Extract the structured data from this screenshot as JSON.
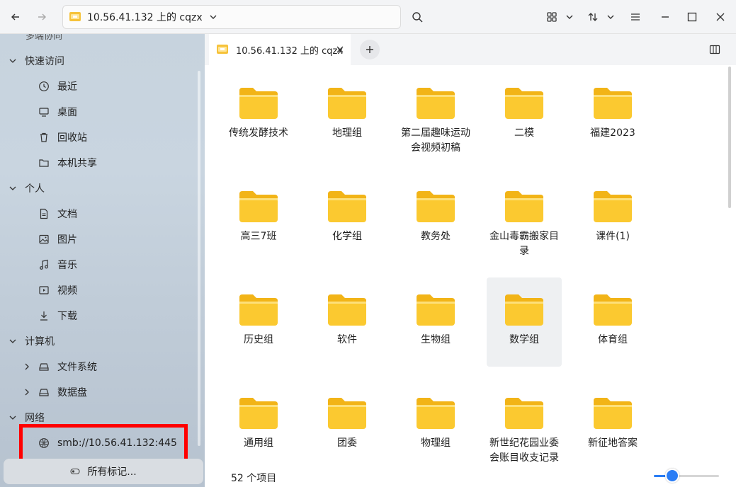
{
  "titlebar": {
    "address": "10.56.41.132 上的 cqzx",
    "icons": [
      "back-arrow-icon",
      "forward-arrow-icon",
      "smb-share-icon",
      "chevron-down-icon",
      "search-icon",
      "grid-view-icon",
      "sort-icon",
      "menu-icon",
      "minimize-icon",
      "maximize-icon",
      "close-icon"
    ]
  },
  "sidebar": {
    "cut_label": "多端协同",
    "groups": [
      {
        "label": "快速访问",
        "items": [
          {
            "label": "最近",
            "icon": "clock-icon"
          },
          {
            "label": "桌面",
            "icon": "desktop-icon"
          },
          {
            "label": "回收站",
            "icon": "trash-icon"
          },
          {
            "label": "本机共享",
            "icon": "folder-icon"
          }
        ]
      },
      {
        "label": "个人",
        "items": [
          {
            "label": "文档",
            "icon": "document-icon"
          },
          {
            "label": "图片",
            "icon": "image-icon"
          },
          {
            "label": "音乐",
            "icon": "music-icon"
          },
          {
            "label": "视频",
            "icon": "video-icon"
          },
          {
            "label": "下载",
            "icon": "download-icon"
          }
        ]
      },
      {
        "label": "计算机",
        "items": [
          {
            "label": "文件系统",
            "icon": "drive-icon"
          },
          {
            "label": "数据盘",
            "icon": "drive-icon"
          }
        ]
      },
      {
        "label": "网络",
        "items": [
          {
            "label": "smb://10.56.41.132:445",
            "icon": "network-icon"
          }
        ]
      }
    ],
    "tags_button": "所有标记..."
  },
  "tabs": [
    {
      "label": "10.56.41.132 上的 cqzx"
    }
  ],
  "folders": [
    "传统发酵技术",
    "地理组",
    "第二届趣味运动会视频初稿",
    "二模",
    "福建2023",
    "高三7班",
    "化学组",
    "教务处",
    "金山毒霸搬家目录",
    "课件(1)",
    "历史组",
    "软件",
    "生物组",
    "数学组",
    "体育组",
    "通用组",
    "团委",
    "物理组",
    "新世纪花园业委会账目收支记录",
    "新征地答案"
  ],
  "selected_folder": "数学组",
  "status": {
    "item_count": "52 个项目",
    "zoom_level": 0.28
  },
  "colors": {
    "accent": "#2a7df5",
    "folder": "#f8c531",
    "highlight": "#ff0000"
  }
}
